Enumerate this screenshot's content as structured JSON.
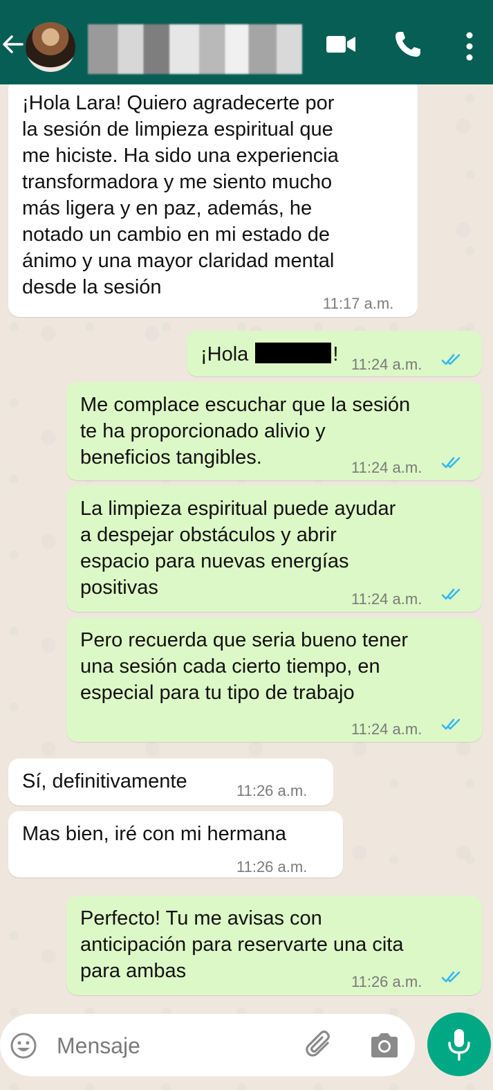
{
  "header": {
    "back_icon": "arrow-left-icon",
    "contact_name_hidden": true,
    "icons": [
      "video-call-icon",
      "voice-call-icon",
      "more-vertical-icon"
    ],
    "color": "#075e54"
  },
  "messages": [
    {
      "direction": "in",
      "text": "¡Hola Lara! Quiero agradecerte por\nla sesión de limpieza espiritual que\nme hiciste. Ha sido una experiencia\ntransformadora y me siento mucho\nmás ligera y en paz, además, he\nnotado un cambio en mi estado de\nánimo y una mayor claridad mental\ndesde la sesión",
      "time": "11:17 a.m."
    },
    {
      "direction": "out",
      "text_before": "¡Hola ",
      "text_after": "!",
      "time": "11:24 a.m.",
      "status": "read"
    },
    {
      "direction": "out",
      "text": "Me complace escuchar que la sesión\nte ha proporcionado alivio y\nbeneficios tangibles.",
      "time": "11:24 a.m.",
      "status": "read"
    },
    {
      "direction": "out",
      "text": "La limpieza espiritual puede ayudar\na despejar obstáculos y abrir\nespacio para nuevas energías\npositivas",
      "time": "11:24 a.m.",
      "status": "read"
    },
    {
      "direction": "out",
      "text": "Pero recuerda que seria bueno tener\nuna sesión cada cierto tiempo, en\nespecial para tu tipo de trabajo",
      "time": "11:24 a.m.",
      "status": "read"
    },
    {
      "direction": "in",
      "text": "Sí, definitivamente",
      "time": "11:26 a.m."
    },
    {
      "direction": "in",
      "text": "Mas bien, iré con mi hermana",
      "time": "11:26 a.m."
    },
    {
      "direction": "out",
      "text": "Perfecto! Tu me avisas con\nanticipación para reservarte una cita\npara ambas",
      "time": "11:26 a.m.",
      "status": "read"
    }
  ],
  "composer": {
    "placeholder": "Mensaje",
    "icons": [
      "emoji-icon",
      "attach-icon",
      "camera-icon",
      "mic-icon"
    ]
  },
  "colors": {
    "incoming_bubble": "#ffffff",
    "outgoing_bubble": "#dcf8c6",
    "read_ticks": "#34b7f1",
    "mic_button": "#00a884"
  }
}
